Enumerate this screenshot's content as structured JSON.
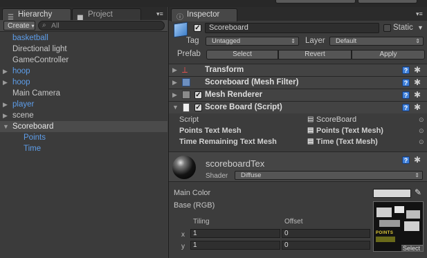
{
  "hierarchy": {
    "tab_label": "Hierarchy",
    "create_label": "Create",
    "search_placeholder": "All",
    "items": [
      {
        "label": "basketball"
      },
      {
        "label": "Directional light"
      },
      {
        "label": "GameController"
      },
      {
        "label": "hoop"
      },
      {
        "label": "hoop"
      },
      {
        "label": "Main Camera"
      },
      {
        "label": "player"
      },
      {
        "label": "scene"
      },
      {
        "label": "Scoreboard"
      },
      {
        "label": "Points"
      },
      {
        "label": "Time"
      }
    ]
  },
  "project": {
    "tab_label": "Project"
  },
  "inspector": {
    "tab_label": "Inspector",
    "object_name": "Scoreboard",
    "static_label": "Static",
    "tag_label": "Tag",
    "tag_value": "Untagged",
    "layer_label": "Layer",
    "layer_value": "Default",
    "prefab_label": "Prefab",
    "prefab_buttons": {
      "select": "Select",
      "revert": "Revert",
      "apply": "Apply"
    },
    "components": [
      {
        "title": "Transform"
      },
      {
        "title": "Scoreboard (Mesh Filter)"
      },
      {
        "title": "Mesh Renderer"
      },
      {
        "title": "Score Board (Script)"
      }
    ],
    "script_props": [
      {
        "label": "Script",
        "value": "ScoreBoard"
      },
      {
        "label": "Points Text Mesh",
        "value": "Points (Text Mesh)"
      },
      {
        "label": "Time Remaining Text Mesh",
        "value": "Time (Text Mesh)"
      }
    ],
    "material": {
      "name": "scoreboardTex",
      "shader_label": "Shader",
      "shader_value": "Diffuse",
      "main_color_label": "Main Color",
      "main_color_value": "#d8d8d8",
      "base_label": "Base (RGB)",
      "tiling_label": "Tiling",
      "offset_label": "Offset",
      "x_label": "x",
      "y_label": "y",
      "tiling_x": "1",
      "tiling_y": "1",
      "offset_x": "0",
      "offset_y": "0",
      "texture_label": "POINTS",
      "select_label": "Select"
    }
  },
  "colors": {
    "link_blue": "#5e9eea",
    "panel_bg": "#3c3c3c",
    "help_blue": "#3e7fd9"
  },
  "help_glyph": "?"
}
